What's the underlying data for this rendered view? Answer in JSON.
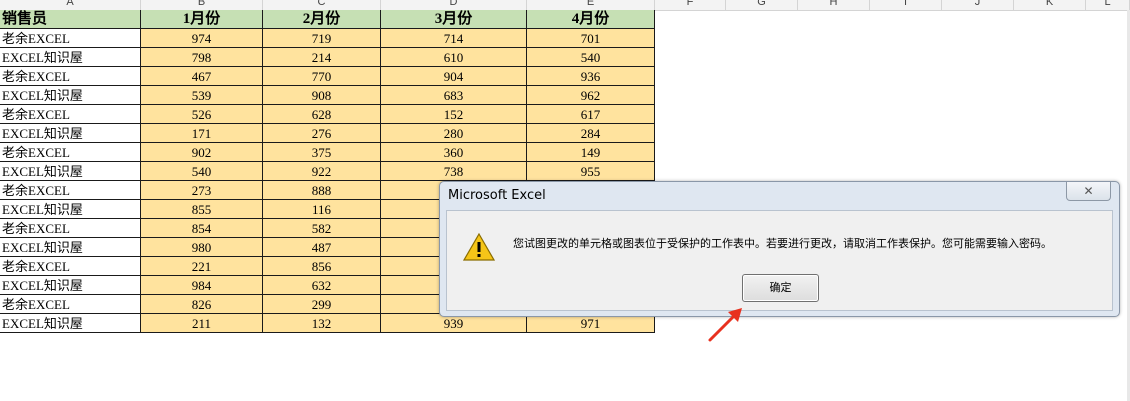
{
  "column_headers": [
    "A",
    "B",
    "C",
    "D",
    "E",
    "F",
    "G",
    "H",
    "I",
    "J",
    "K",
    "L"
  ],
  "table": {
    "headers": [
      "销售员",
      "1月份",
      "2月份",
      "3月份",
      "4月份"
    ],
    "rows": [
      [
        "老余EXCEL",
        "974",
        "719",
        "714",
        "701"
      ],
      [
        "EXCEL知识屋",
        "798",
        "214",
        "610",
        "540"
      ],
      [
        "老余EXCEL",
        "467",
        "770",
        "904",
        "936"
      ],
      [
        "EXCEL知识屋",
        "539",
        "908",
        "683",
        "962"
      ],
      [
        "老余EXCEL",
        "526",
        "628",
        "152",
        "617"
      ],
      [
        "EXCEL知识屋",
        "171",
        "276",
        "280",
        "284"
      ],
      [
        "老余EXCEL",
        "902",
        "375",
        "360",
        "149"
      ],
      [
        "EXCEL知识屋",
        "540",
        "922",
        "738",
        "955"
      ],
      [
        "老余EXCEL",
        "273",
        "888",
        "",
        ""
      ],
      [
        "EXCEL知识屋",
        "855",
        "116",
        "",
        ""
      ],
      [
        "老余EXCEL",
        "854",
        "582",
        "",
        ""
      ],
      [
        "EXCEL知识屋",
        "980",
        "487",
        "",
        ""
      ],
      [
        "老余EXCEL",
        "221",
        "856",
        "",
        ""
      ],
      [
        "EXCEL知识屋",
        "984",
        "632",
        "",
        ""
      ],
      [
        "老余EXCEL",
        "826",
        "299",
        "",
        ""
      ],
      [
        "EXCEL知识屋",
        "211",
        "132",
        "939",
        "971"
      ]
    ]
  },
  "dialog": {
    "title": "Microsoft Excel",
    "close_label": "✕",
    "message": "您试图更改的单元格或图表位于受保护的工作表中。若要进行更改，请取消工作表保护。您可能需要输入密码。",
    "ok_label": "确定",
    "icon": "warning-icon"
  },
  "annotation": {
    "arrow_color": "#e8311f",
    "icon": "red-arrow-icon"
  },
  "colors": {
    "header_fill": "#c6e0b4",
    "data_fill": "#ffe39e"
  }
}
